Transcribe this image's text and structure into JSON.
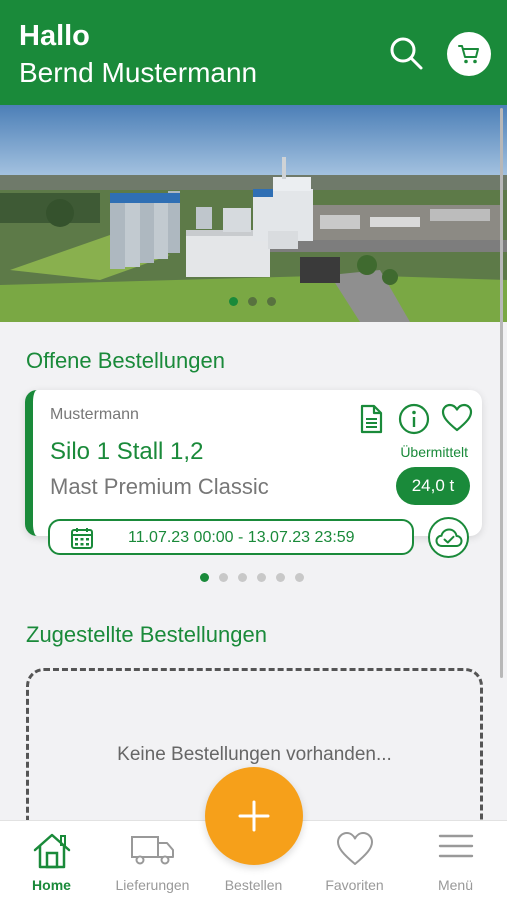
{
  "header": {
    "greeting": "Hallo",
    "user_name": "Bernd Mustermann"
  },
  "banner": {
    "slide_count": 3,
    "active_slide": 1
  },
  "open_orders": {
    "title": "Offene Bestellungen",
    "cards": [
      {
        "customer": "Mustermann",
        "silo": "Silo 1 Stall 1,2",
        "product": "Mast Premium Classic",
        "status": "Übermittelt",
        "amount": "24,0 t",
        "date_range": "11.07.23 00:00 - 13.07.23 23:59"
      }
    ],
    "page_count": 6,
    "active_page": 1
  },
  "delivered_orders": {
    "title": "Zugestellte Bestellungen",
    "empty_text": "Keine Bestellungen vorhanden..."
  },
  "tabbar": {
    "items": [
      {
        "label": "Home",
        "icon": "home-icon",
        "active": true
      },
      {
        "label": "Lieferungen",
        "icon": "truck-icon"
      },
      {
        "label": "Bestellen",
        "icon": "plus-icon"
      },
      {
        "label": "Favoriten",
        "icon": "heart-icon"
      },
      {
        "label": "Menü",
        "icon": "menu-icon"
      }
    ]
  },
  "colors": {
    "primary": "#1a8a3a",
    "accent": "#f6a01a",
    "background": "#f2f2f4"
  }
}
